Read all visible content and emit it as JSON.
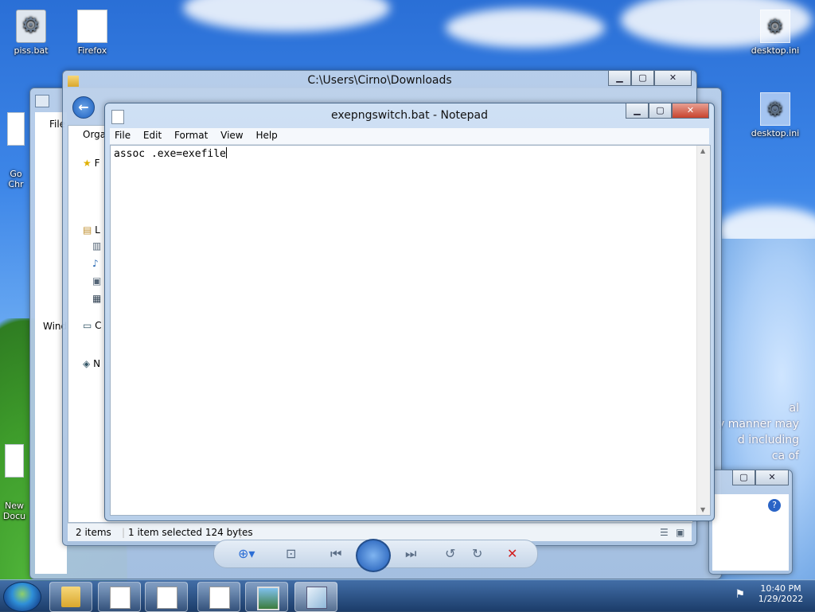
{
  "desktop": {
    "icons": [
      {
        "label": "piss.bat"
      },
      {
        "label": "Firefox"
      },
      {
        "label": "desktop.ini"
      },
      {
        "label": "desktop.ini"
      },
      {
        "label": "Go\nChr"
      },
      {
        "label": "New\nDocu"
      }
    ],
    "wallpaper_text": {
      "line1": "al",
      "line2": "y manner may",
      "line3": "d including",
      "line4": "ca  of"
    }
  },
  "explorer_back": {
    "menu_fragment": "File",
    "side_fragment": "Wind"
  },
  "explorer": {
    "title": "C:\\Users\\Cirno\\Downloads",
    "organize_fragment": "Orga",
    "status_items": "2 items",
    "status_selected": "1 item selected  124 bytes",
    "side_letters": [
      "F",
      "L",
      "C",
      "N"
    ]
  },
  "notepad": {
    "title": "exepngswitch.bat - Notepad",
    "menu": [
      "File",
      "Edit",
      "Format",
      "View",
      "Help"
    ],
    "content": "assoc .exe=exefile"
  },
  "taskbar": {
    "time": "10:40 PM",
    "date": "1/29/2022"
  }
}
